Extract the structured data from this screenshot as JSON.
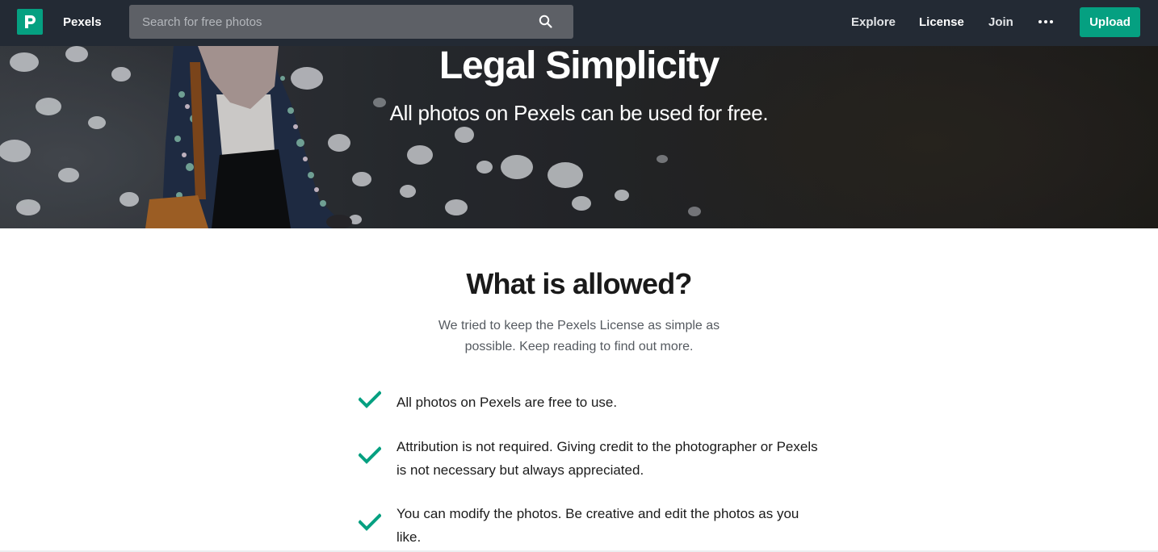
{
  "navbar": {
    "brand": "Pexels",
    "search_placeholder": "Search for free photos",
    "links": {
      "explore": "Explore",
      "license": "License",
      "join": "Join"
    },
    "more_icon": "more-dots-icon",
    "upload_label": "Upload"
  },
  "hero": {
    "title": "Legal Simplicity",
    "subtitle": "All photos on Pexels can be used for free."
  },
  "allowed": {
    "title": "What is allowed?",
    "intro": "We tried to keep the Pexels License as simple as possible. Keep reading to find out more.",
    "check_icon": "check-icon",
    "items": [
      "All photos on Pexels are free to use.",
      "Attribution is not required. Giving credit to the photographer or Pexels is not necessary but always appreciated.",
      "You can modify the photos. Be creative and edit the photos as you like."
    ]
  },
  "colors": {
    "brand_green": "#05a081",
    "navbar_bg": "#232a34",
    "search_bg": "#5d6066"
  }
}
